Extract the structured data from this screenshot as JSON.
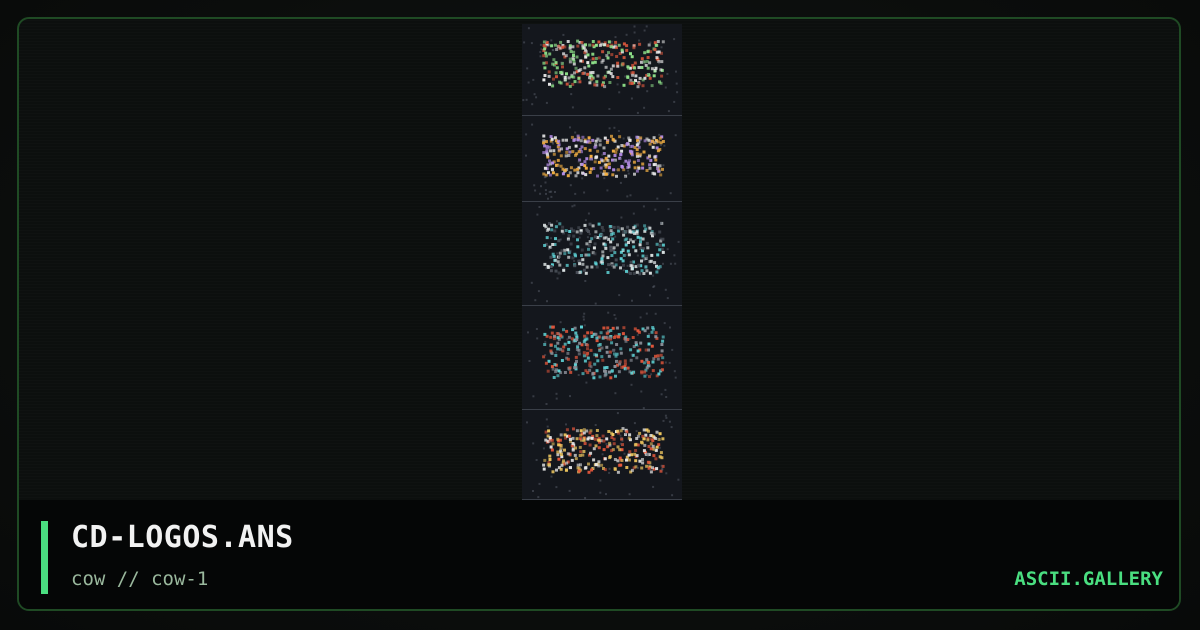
{
  "artwork": {
    "icon": "ansi-art-preview",
    "blocks": [
      {
        "palette": [
          "#e8e8e8",
          "#8fe28a",
          "#d8563c"
        ]
      },
      {
        "palette": [
          "#e8e8e8",
          "#f4b043",
          "#b48ce6"
        ]
      },
      {
        "palette": [
          "#dfe6e6",
          "#5ed3d6",
          "#4a4f58"
        ]
      },
      {
        "palette": [
          "#5ed3d6",
          "#e0553a",
          "#8a8f98"
        ]
      },
      {
        "palette": [
          "#f0c860",
          "#e8583c",
          "#e8e8e8"
        ]
      }
    ]
  },
  "footer": {
    "title": "CD-LOGOS.ANS",
    "subtitle": "cow // cow-1",
    "brand": "ASCII.GALLERY"
  },
  "colors": {
    "accent": "#4ade80",
    "border": "#1f4a24",
    "background": "#0c0f0e"
  }
}
